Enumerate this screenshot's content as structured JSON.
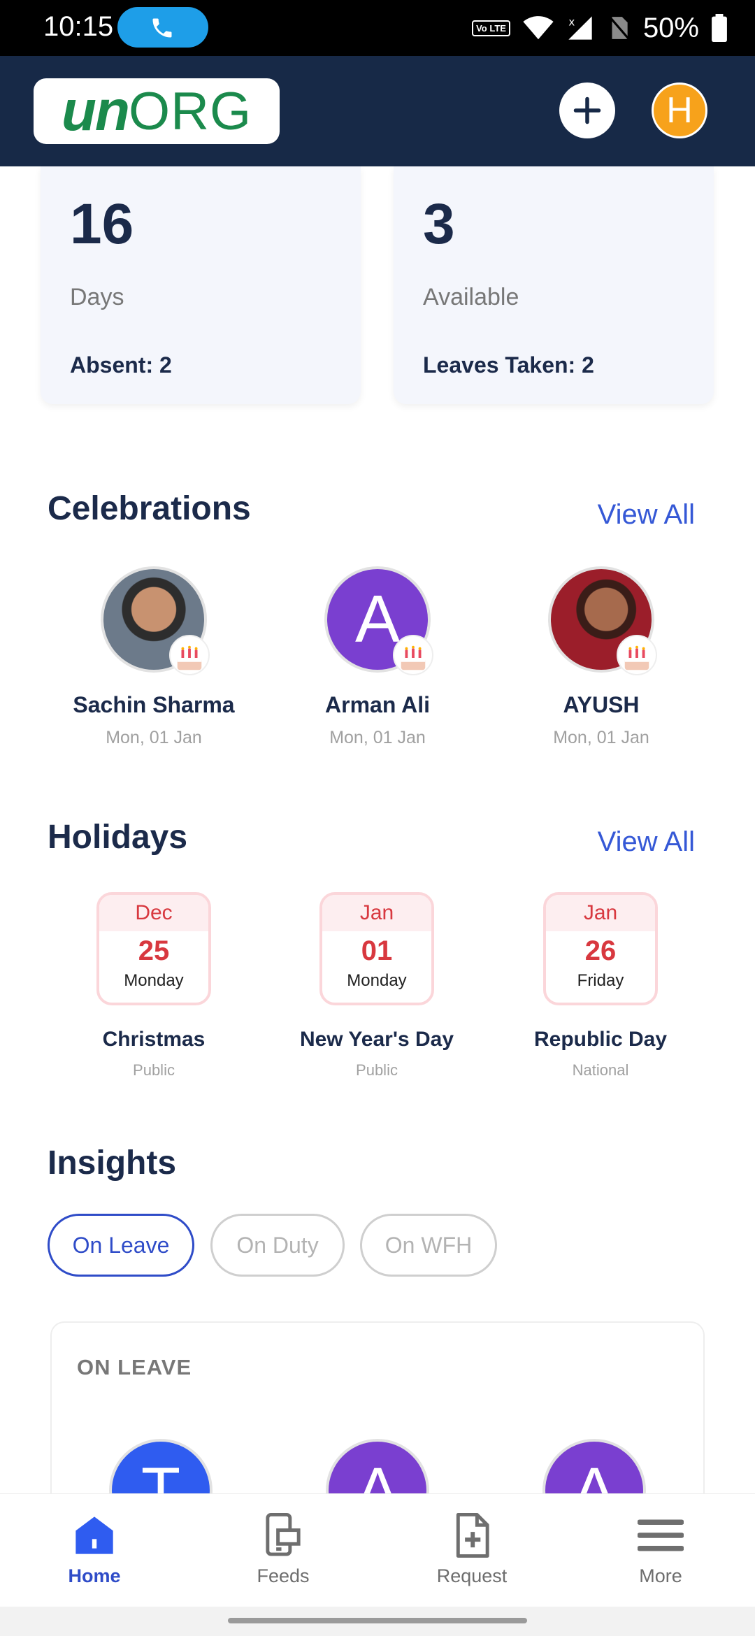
{
  "status_bar": {
    "time": "10:15",
    "volte": "Vo LTE",
    "battery": "50%"
  },
  "header": {
    "logo_un": "un",
    "logo_org": "ORG",
    "avatar_initial": "H"
  },
  "stats": [
    {
      "value": "16",
      "unit": "Days",
      "sub": "Absent: 2"
    },
    {
      "value": "3",
      "unit": "Available",
      "sub": "Leaves Taken: 2"
    }
  ],
  "celebrations": {
    "title": "Celebrations",
    "view_all": "View All",
    "items": [
      {
        "name": "Sachin Sharma",
        "date": "Mon, 01 Jan",
        "avatar": "photo"
      },
      {
        "name": "Arman Ali",
        "date": "Mon, 01 Jan",
        "avatar": "A"
      },
      {
        "name": "AYUSH",
        "date": "Mon, 01 Jan",
        "avatar": "photo"
      }
    ]
  },
  "holidays": {
    "title": "Holidays",
    "view_all": "View All",
    "items": [
      {
        "month": "Dec",
        "day": "25",
        "weekday": "Monday",
        "name": "Christmas",
        "type": "Public"
      },
      {
        "month": "Jan",
        "day": "01",
        "weekday": "Monday",
        "name": "New Year's Day",
        "type": "Public"
      },
      {
        "month": "Jan",
        "day": "26",
        "weekday": "Friday",
        "name": "Republic Day",
        "type": "National"
      }
    ]
  },
  "insights": {
    "title": "Insights",
    "chips": [
      "On Leave",
      "On Duty",
      "On WFH"
    ],
    "active_chip": "On Leave",
    "card_title": "ON LEAVE",
    "avatars": [
      {
        "initial": "T",
        "color": "#2f5cf0"
      },
      {
        "initial": "A",
        "color": "#7a3fd0"
      },
      {
        "initial": "A",
        "color": "#7a3fd0"
      }
    ]
  },
  "bottom_nav": {
    "items": [
      "Home",
      "Feeds",
      "Request",
      "More"
    ],
    "active": "Home"
  },
  "colors": {
    "header_bg": "#172947",
    "accent": "#2f4cc8",
    "brand_green": "#1b8a4c",
    "holiday_red": "#d8383f"
  }
}
